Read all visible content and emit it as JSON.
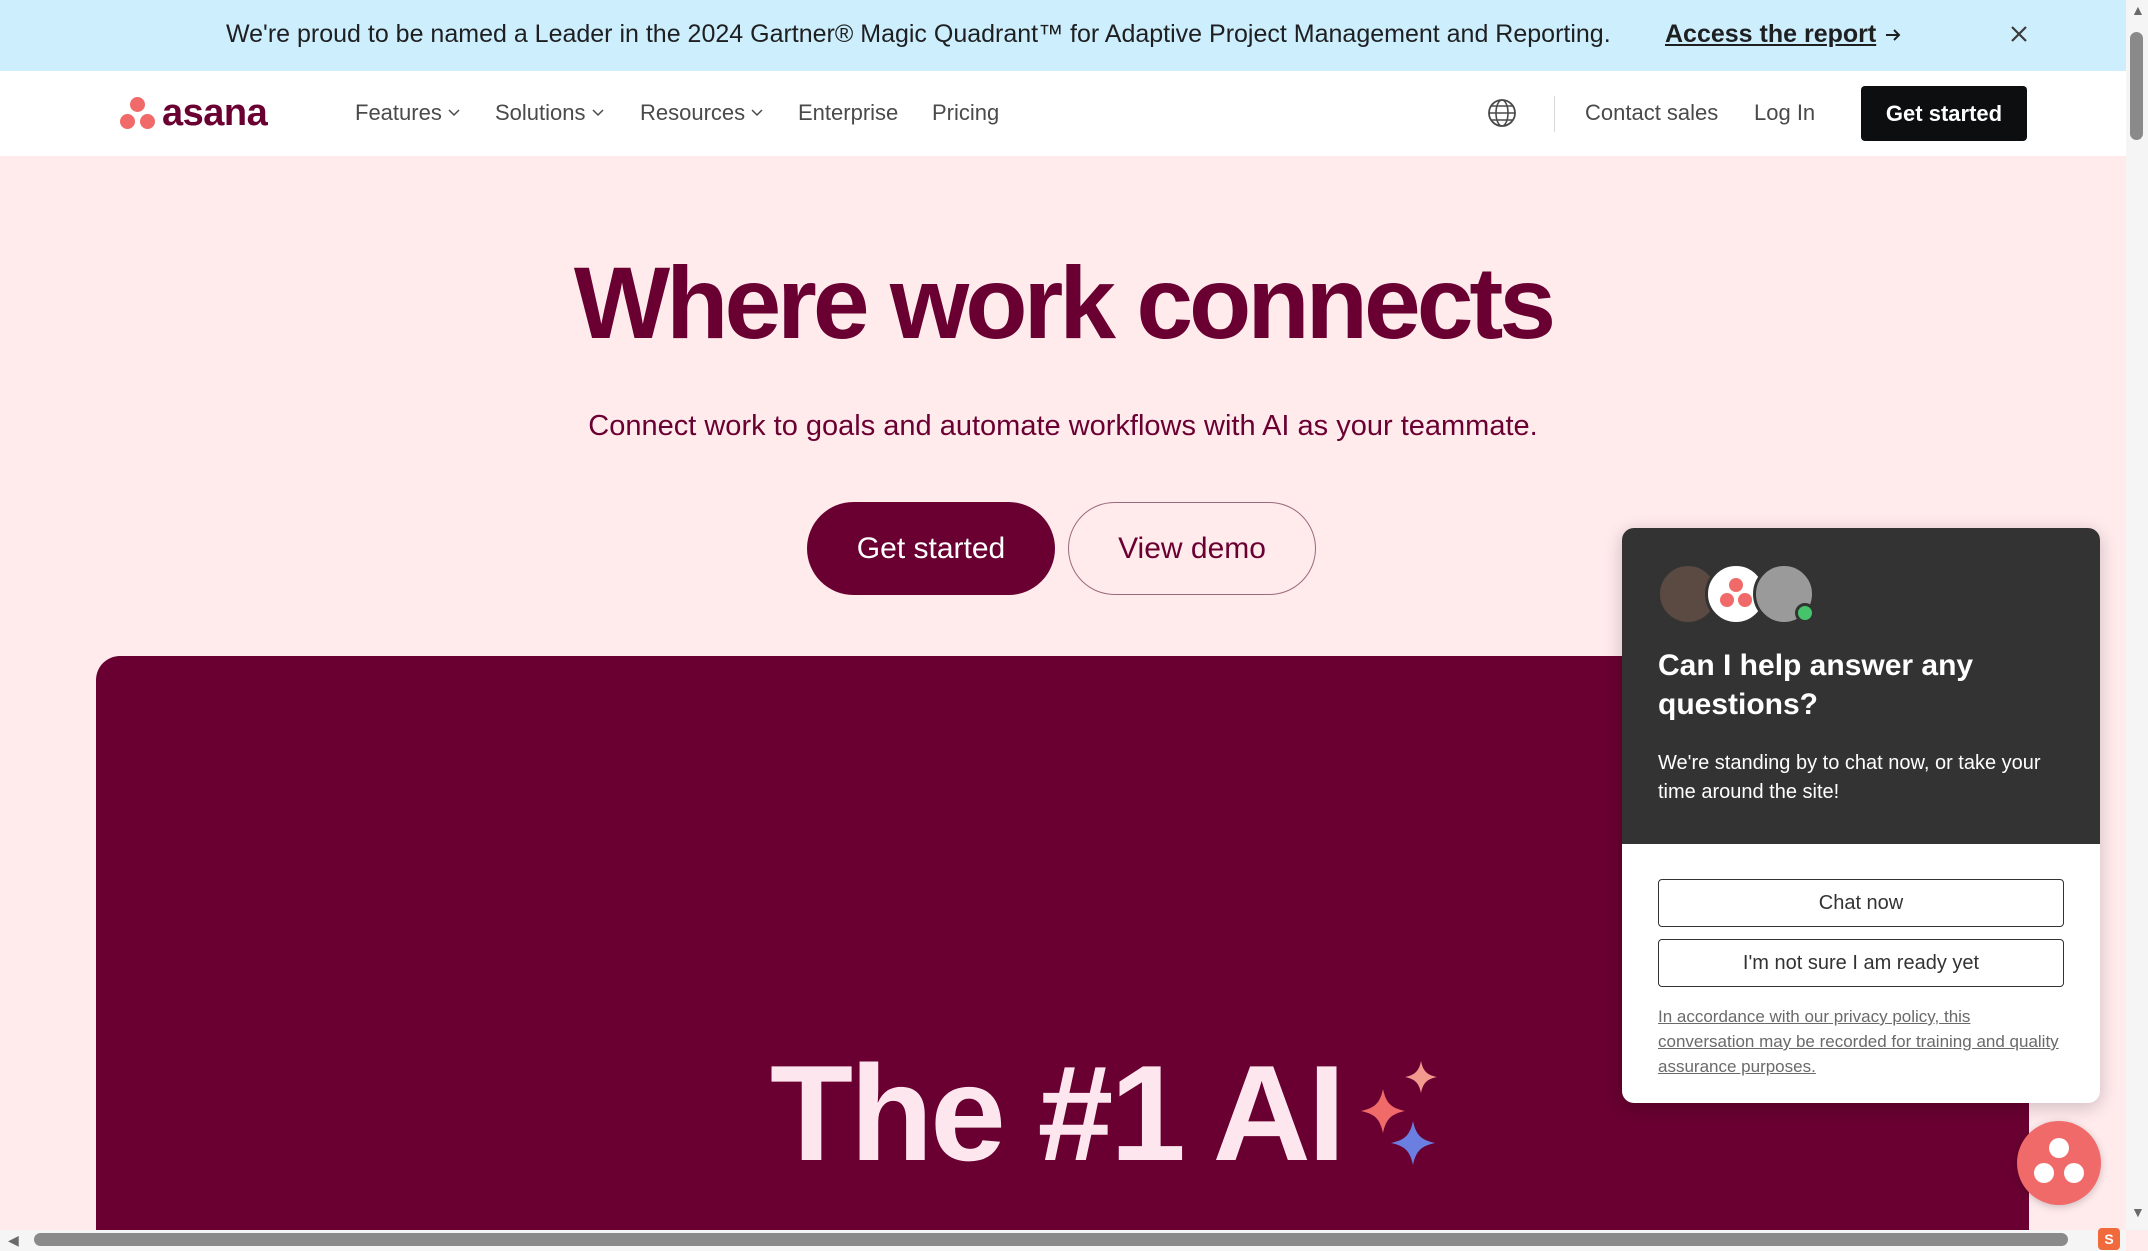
{
  "banner": {
    "text": "We're proud to be named a Leader in the 2024 Gartner® Magic Quadrant™ for Adaptive Project Management and Reporting.",
    "link_label": "Access the report",
    "link_icon": "arrow-right-icon",
    "close_icon": "close-icon"
  },
  "nav": {
    "logo_text": "asana",
    "items": [
      {
        "label": "Features",
        "has_dropdown": true
      },
      {
        "label": "Solutions",
        "has_dropdown": true
      },
      {
        "label": "Resources",
        "has_dropdown": true
      },
      {
        "label": "Enterprise",
        "has_dropdown": false
      },
      {
        "label": "Pricing",
        "has_dropdown": false
      }
    ],
    "globe_icon": "globe-icon",
    "contact_sales": "Contact sales",
    "log_in": "Log In",
    "get_started": "Get started"
  },
  "hero": {
    "title": "Where work connects",
    "subtitle": "Connect work to goals and automate workflows with AI as your teammate.",
    "primary_button": "Get started",
    "secondary_button": "View demo"
  },
  "panel": {
    "headline": "The #1 AI",
    "sparkle_icon": "sparkle-icon"
  },
  "chat": {
    "title": "Can I help answer any questions?",
    "body": "We're standing by to chat now, or take your time around the site!",
    "chat_now": "Chat now",
    "not_ready": "I'm not sure I am ready yet",
    "note": "In accordance with our privacy policy, this conversation may be recorded for training and quality assurance purposes."
  },
  "colors": {
    "brand": "#690031",
    "coral": "#f06a6a",
    "banner_bg": "#cdeefc",
    "page_bg": "#ffeaec",
    "chat_dark": "#333333"
  }
}
